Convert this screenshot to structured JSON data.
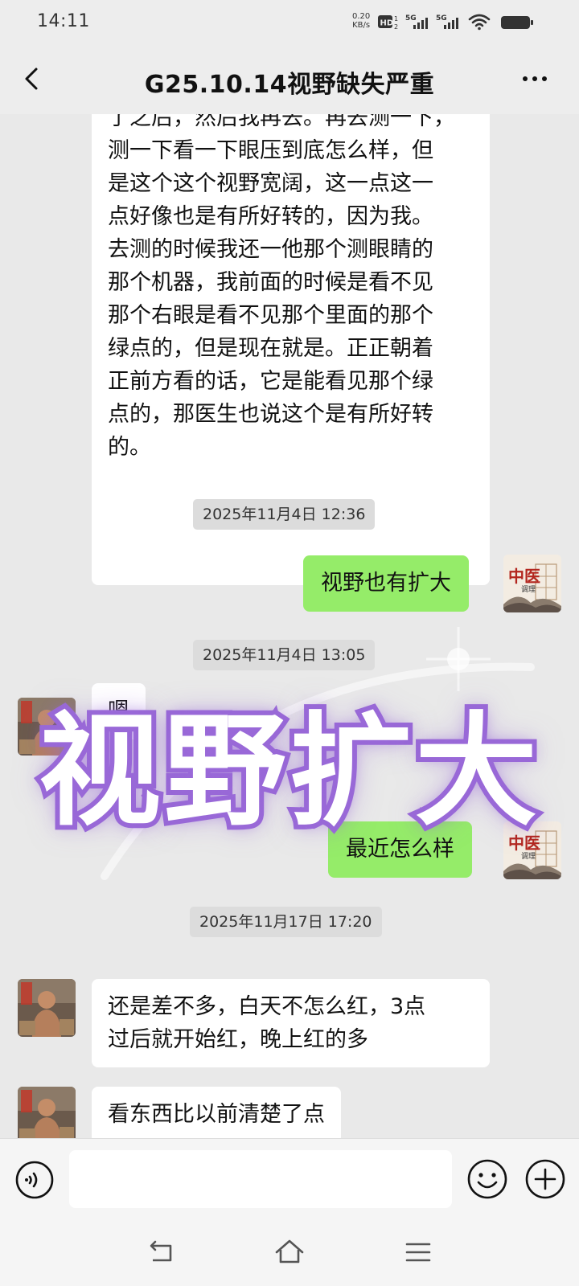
{
  "status_bar": {
    "time": "14:11",
    "net_speed_value": "0.20",
    "net_speed_unit": "KB/s",
    "hd_label": "HD",
    "sim1_label": "5G",
    "sim2_label": "5G",
    "icons": [
      "hd-icon",
      "signal-5g-icon",
      "signal-5g-icon",
      "wifi-icon",
      "battery-icon"
    ]
  },
  "header": {
    "title": "G25.10.14视野缺失严重",
    "back_icon": "back-arrow-icon",
    "more_icon": "more-dots-icon"
  },
  "messages": [
    {
      "type": "in",
      "lines": [
        "了之后，然后我再去。再去测一下，",
        "测一下看一下眼压到底怎么样，但",
        "是这个这个视野宽阔，这一点这一",
        "点好像也是有所好转的，因为我。",
        "去测的时候我还一他那个测眼睛的",
        "那个机器，我前面的时候是看不见",
        "那个右眼是看不见那个里面的那个",
        "绿点的，但是现在就是。正正朝着",
        "正前方看的话，它是能看见那个绿",
        "点的，那医生也说这个是有所好转",
        "的。"
      ]
    },
    {
      "type": "time",
      "text": "2025年11月4日 12:36"
    },
    {
      "type": "out",
      "text": "视野也有扩大"
    },
    {
      "type": "time",
      "text": "2025年11月4日 13:05"
    },
    {
      "type": "in",
      "text": "嗯"
    },
    {
      "type": "out",
      "text": "最近怎么样"
    },
    {
      "type": "time",
      "text": "2025年11月17日 17:20"
    },
    {
      "type": "in",
      "lines": [
        "还是差不多，白天不怎么红，3点",
        "过后就开始红，晚上红的多"
      ]
    },
    {
      "type": "in",
      "text": "看东西比以前清楚了点"
    }
  ],
  "overlay": {
    "text": "视野扩大",
    "stroke_color": "#9a6ad8",
    "fill_color": "#ffffff"
  },
  "my_avatar": {
    "badge": "中医",
    "sub": "调理"
  },
  "input_bar": {
    "value": "",
    "voice_icon": "voice-icon",
    "emoji_icon": "emoji-icon",
    "plus_icon": "plus-icon"
  },
  "nav_bar": {
    "icons": [
      "back-nav-icon",
      "home-icon",
      "menu-icon"
    ]
  },
  "colors": {
    "background": "#ededed",
    "bubble_out": "#95ec69",
    "bubble_in": "#ffffff",
    "timestamp_bg": "#dcdcdc"
  }
}
